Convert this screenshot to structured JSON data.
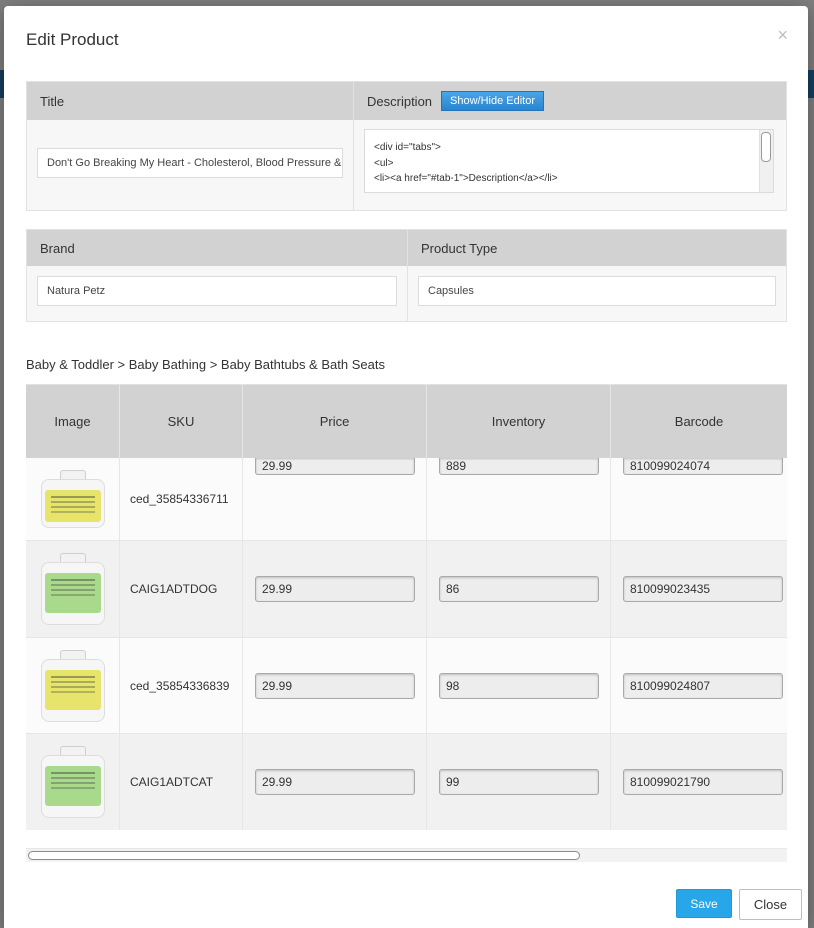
{
  "modal": {
    "title": "Edit Product",
    "close_glyph": "×"
  },
  "details": {
    "title_label": "Title",
    "title_value": "Don't Go Breaking My Heart - Cholesterol, Blood Pressure & Heart Support",
    "description_label": "Description",
    "editor_button": "Show/Hide Editor",
    "description_lines": [
      "<div id=\"tabs\">",
      "<ul>",
      "<li><a href=\"#tab-1\">Description</a></li>"
    ]
  },
  "attributes": {
    "brand_label": "Brand",
    "brand_value": "Natura Petz",
    "type_label": "Product Type",
    "type_value": "Capsules"
  },
  "breadcrumb": "Baby & Toddler > Baby Bathing > Baby Bathtubs & Bath Seats",
  "variants": {
    "columns": [
      "Image",
      "SKU",
      "Price",
      "Inventory",
      "Barcode"
    ],
    "rows": [
      {
        "sku": "ced_35854336711",
        "price": "29.99",
        "inventory": "889",
        "barcode": "810099024074",
        "label_color": "#e6e46a"
      },
      {
        "sku": "CAIG1ADTDOG",
        "price": "29.99",
        "inventory": "86",
        "barcode": "810099023435",
        "label_color": "#a9d98a"
      },
      {
        "sku": "ced_35854336839",
        "price": "29.99",
        "inventory": "98",
        "barcode": "810099024807",
        "label_color": "#e6e46a"
      },
      {
        "sku": "CAIG1ADTCAT",
        "price": "29.99",
        "inventory": "99",
        "barcode": "810099021790",
        "label_color": "#a9d98a"
      }
    ]
  },
  "footer": {
    "save_label": "Save",
    "close_label": "Close"
  },
  "colors": {
    "accent": "#27a7ea",
    "header_gray": "#d2d2d2"
  }
}
